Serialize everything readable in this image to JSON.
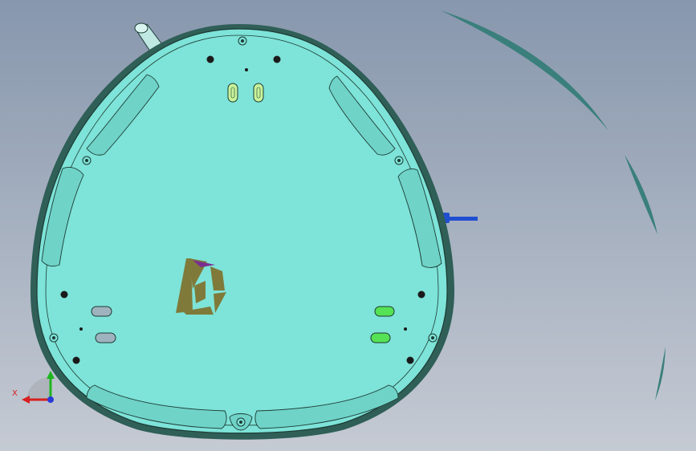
{
  "viewport": {
    "background_top": "#8797ad",
    "background_bottom": "#c5cad3"
  },
  "model": {
    "name": "robot-vacuum-base",
    "body_fill": "#7ee3d8",
    "outline_color": "#1c3b34",
    "shadow_color": "#2f5f57",
    "bumper_arc_color": "#3a7f7c",
    "cable_color": "#1f4fd0"
  },
  "slots": {
    "top_left_color": "#c8f39a",
    "top_right_color": "#c8f39a",
    "left_upper_color": "#9fb3bf",
    "left_lower_color": "#9fb3bf",
    "right_upper_color": "#55e255",
    "right_lower_color": "#55e255"
  },
  "logo": {
    "fill_color": "#7f7a3a",
    "accent_color": "#7a2f8f"
  },
  "triad": {
    "x_label": "X",
    "x_axis_color": "#d61f1f",
    "y_axis_color": "#1fb51f",
    "z_axis_color": "#2a3ad6"
  }
}
